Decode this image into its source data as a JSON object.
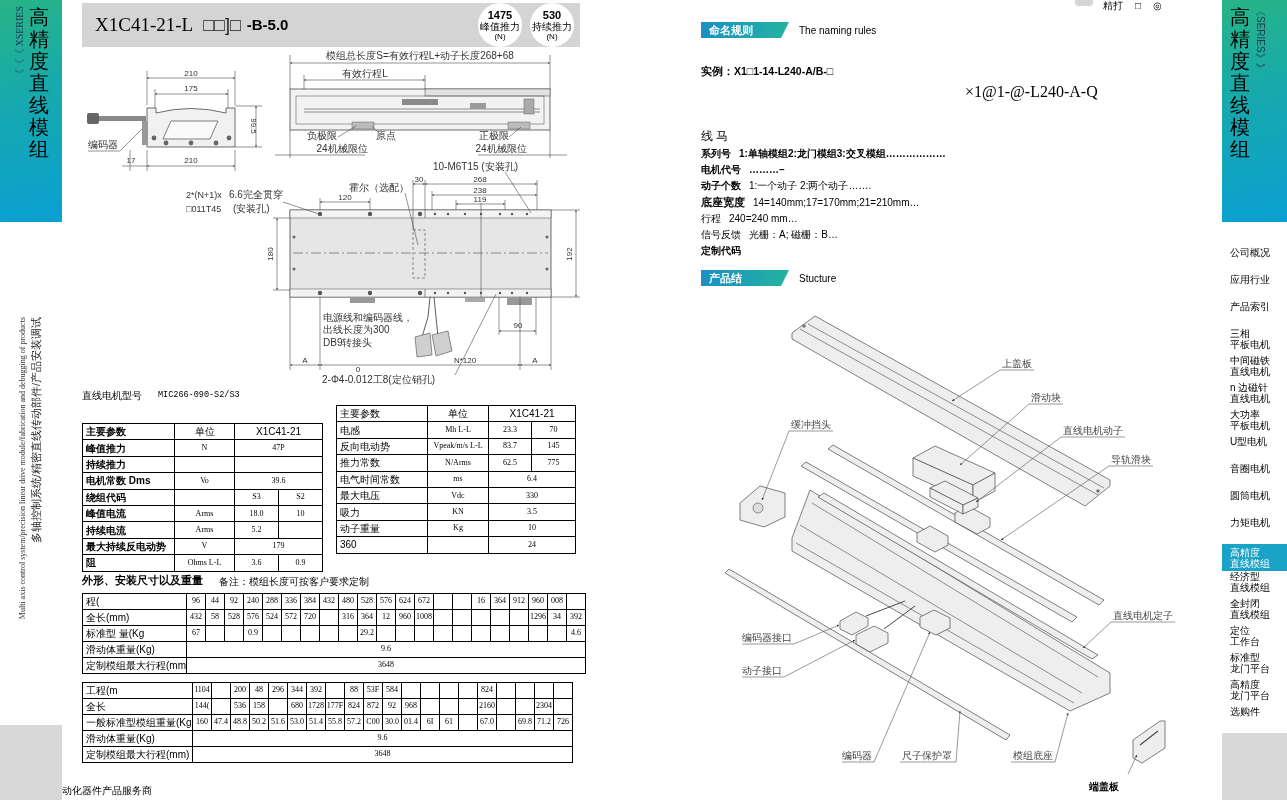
{
  "left_sidebar": {
    "series": "《《《 XSERIES",
    "title": "高精度直线模组",
    "tagline_en": "Multi axis control system/precision linear drive module/fabrication and debugging of products",
    "tagline_cn": "多轴控制系统/精密直线传动部件/产品安装调试"
  },
  "header": {
    "model": "X1C41-21-L",
    "code": "□□]□",
    "suffix": "-B-5.0",
    "badges": [
      {
        "value": "1475",
        "label": "峰值推力",
        "unit": "(N)"
      },
      {
        "value": "530",
        "label": "持续推力",
        "unit": "(N)"
      }
    ]
  },
  "drawings": {
    "side_view": [
      "210",
      "175",
      "99.5",
      "编码器",
      "17",
      "210"
    ],
    "top_view": [
      "模组总长度S=有效行程L+动子长度268+68",
      "有效行程L",
      "负极限",
      "原点",
      "正极限",
      "24机械限位",
      "24机械限位"
    ],
    "plan_view": [
      "10-M6T15 (安装孔)",
      "2*(N+1)x",
      "6.6完全贯穿",
      "□011T45",
      "(安装孔)",
      "霍尔（选配）",
      "30",
      "268",
      "238",
      "119",
      "120",
      "180",
      "192",
      "电源线和编码器线，",
      "出线长度为300",
      "DB9转接头",
      "90",
      "A",
      "N*120",
      "A",
      "0",
      "2-Φ4-0.012工8(定位销孔)"
    ]
  },
  "motor_model": {
    "label": "直线电机型号",
    "value": "MIC266-090-S2/S3"
  },
  "spec_table_left": {
    "rows": [
      [
        "主要参数",
        "单位",
        {
          "text": "X1C41-21",
          "colspan": 2
        }
      ],
      [
        "峰值推力",
        "N",
        {
          "text": "47P",
          "colspan": 2
        }
      ],
      [
        "持续推力",
        null,
        null
      ],
      [
        "电机常数 Dms",
        "Vo",
        {
          "text": "39.6",
          "colspan": 2
        }
      ],
      [
        "绕组代码",
        null,
        "S3",
        "S2"
      ],
      [
        "峰值电流",
        "Arms",
        "18.0",
        "10"
      ],
      [
        "持续电流",
        "Arms",
        "5.2",
        null
      ],
      [
        "最大持续反电动势",
        "V",
        {
          "text": "179",
          "colspan": 2
        }
      ],
      [
        "阻",
        "Ohms L-L",
        "3.6",
        "0.9"
      ]
    ]
  },
  "spec_table_right": {
    "rows": [
      [
        "主要参数",
        "单位",
        {
          "text": "X1C41-21",
          "colspan": 2
        }
      ],
      [
        "电感",
        "Mh L-L",
        "23.3",
        "70"
      ],
      [
        "反向电动势",
        "Vpeak/m/s L-L",
        "83.7",
        "145"
      ],
      [
        "推力常数",
        "N/Arms",
        "62.5",
        "775"
      ],
      [
        "电气时间常数",
        "ms",
        {
          "text": "6.4",
          "colspan": 2
        }
      ],
      [
        "最大电压",
        "Vdc",
        {
          "text": "330",
          "colspan": 2
        }
      ],
      [
        "吸力",
        "KN",
        {
          "text": "3.5",
          "colspan": 2
        }
      ],
      [
        "动子重量",
        "Kg",
        {
          "text": "10",
          "colspan": 2
        }
      ],
      [
        "360",
        null,
        {
          "text": "24",
          "colspan": 2
        }
      ]
    ]
  },
  "dimensions_heading": {
    "title": "外形、安装尺寸以及重量",
    "note": "备注：模组长度可按客户要求定制"
  },
  "stroke_table": {
    "rows": [
      [
        "程(",
        "96",
        "44",
        "92",
        "240",
        "288",
        "336",
        "384",
        "432",
        "480",
        "528",
        "576",
        "624",
        "672",
        null,
        null,
        "16",
        "364",
        "912",
        "960",
        "008",
        null
      ],
      [
        "全长(mm)",
        "432",
        "58",
        "528",
        "576",
        "524",
        "572",
        "720",
        null,
        "316",
        "364",
        "12",
        "960",
        "1008",
        null,
        null,
        null,
        null,
        null,
        "1296",
        "34",
        "392"
      ],
      [
        "标准型 量(Kg",
        "67",
        null,
        null,
        "0.9",
        null,
        null,
        null,
        null,
        null,
        "29.2",
        null,
        null,
        null,
        null,
        null,
        null,
        null,
        null,
        null,
        null,
        "4.6"
      ],
      [
        "滑动体重量(Kg)",
        {
          "text": "9.6",
          "colspan": 21
        }
      ],
      [
        "定制模组最大行程(mm",
        {
          "text": "3648",
          "colspan": 21
        }
      ]
    ]
  },
  "stroke_table_2": {
    "rows": [
      [
        "工程(m",
        "1104",
        null,
        "200",
        "48",
        "296",
        "344",
        "392",
        null,
        "88",
        "53F",
        "584",
        null,
        null,
        null,
        null,
        "824",
        null,
        null,
        null,
        null
      ],
      [
        "全长",
        "144(",
        null,
        "536",
        "158",
        null,
        "680",
        "1728",
        "177F",
        "824",
        "872",
        "92",
        "968",
        null,
        null,
        null,
        "2160",
        null,
        null,
        "2304",
        null
      ],
      [
        "一般标准型模组重量(Kg",
        "160",
        "47.4",
        "48.8",
        "50.2",
        "51.6",
        "53.0",
        "51.4",
        "55.8",
        "57.2",
        "C00",
        "30.0",
        "01.4",
        "6I",
        "61",
        null,
        "67.0",
        null,
        "69.8",
        "71.2",
        "726"
      ],
      [
        "滑动体重量(Kg)",
        {
          "text": "9.6",
          "colspan": 20
        }
      ],
      [
        "定制模组最大行程(mm)",
        {
          "text": "3648",
          "colspan": 20
        }
      ]
    ]
  },
  "footer": "动化器件产品服务商",
  "top_fragment": {
    "label": "精打",
    "symbols": [
      "□",
      "◎"
    ]
  },
  "naming": {
    "badge": "命名规则",
    "title": "The naming rules",
    "example": "实例：X1□1-14-L240-A/B-□",
    "formula": "×1@1-@-L240-A-Q",
    "heading": "线 马",
    "items": [
      {
        "kind": "strong",
        "label": "系列号",
        "text": "1:单轴模组2:龙门模组3:交叉模组………………"
      },
      {
        "kind": "strong",
        "label": "电机代号",
        "text": "………–"
      },
      {
        "kind": "lead",
        "label": "动子个数",
        "text": "1:一个动子  2:两个动子……."
      },
      {
        "kind": "large",
        "label": "底座宽度",
        "text": "14=140mm;17=170mm;21=210mm…"
      },
      {
        "kind": "plain",
        "label": "行程",
        "text": "240=240  mm…"
      },
      {
        "kind": "plain",
        "label": "信号反馈",
        "text": "光栅：A;   磁栅：B…"
      },
      {
        "kind": "strong",
        "label": "定制代码"
      }
    ]
  },
  "structure": {
    "badge": "产品结",
    "title": "Stucture",
    "labels": [
      "上盖板",
      "滑动块",
      "缓冲挡头",
      "直线电机动子",
      "导轨滑块",
      "直线电机定子",
      "编码器接口",
      "动子接口",
      "编码器",
      "尺子保护罩",
      "模组底座",
      "端盖板"
    ]
  },
  "right_sidebar": {
    "title": "高精度直线模组",
    "series": "《SERIES》》",
    "nav": [
      {
        "lines": [
          "公司概况"
        ],
        "selected": false
      },
      {
        "lines": [
          "应用行业"
        ],
        "selected": false
      },
      {
        "lines": [
          "产品索引"
        ],
        "selected": false
      },
      {
        "lines": [
          "三相",
          "平板电机"
        ],
        "selected": false
      },
      {
        "lines": [
          "中间磁铁",
          "直线电机"
        ],
        "selected": false
      },
      {
        "lines": [
          "n 边磁针",
          "直线电机"
        ],
        "selected": false
      },
      {
        "lines": [
          "大功率",
          "平板电机"
        ],
        "selected": false
      },
      {
        "lines": [
          "U型电机"
        ],
        "selected": false
      },
      {
        "lines": [
          "音圈电机"
        ],
        "selected": false
      },
      {
        "lines": [
          "圆筒电机"
        ],
        "selected": false
      },
      {
        "lines": [
          "力矩电机"
        ],
        "selected": false
      },
      {
        "lines": [
          "高精度",
          "直线模组"
        ],
        "selected": true
      },
      {
        "lines": [
          "经济型",
          "直线模组"
        ],
        "selected": false
      },
      {
        "lines": [
          "全封闭",
          "直线模组"
        ],
        "selected": false
      },
      {
        "lines": [
          "定位",
          "工作台"
        ],
        "selected": false
      },
      {
        "lines": [
          "标准型",
          "龙门平台"
        ],
        "selected": false
      },
      {
        "lines": [
          "高精度",
          "龙门平台"
        ],
        "selected": false
      },
      {
        "lines": [
          "选购件"
        ],
        "selected": false
      }
    ]
  }
}
